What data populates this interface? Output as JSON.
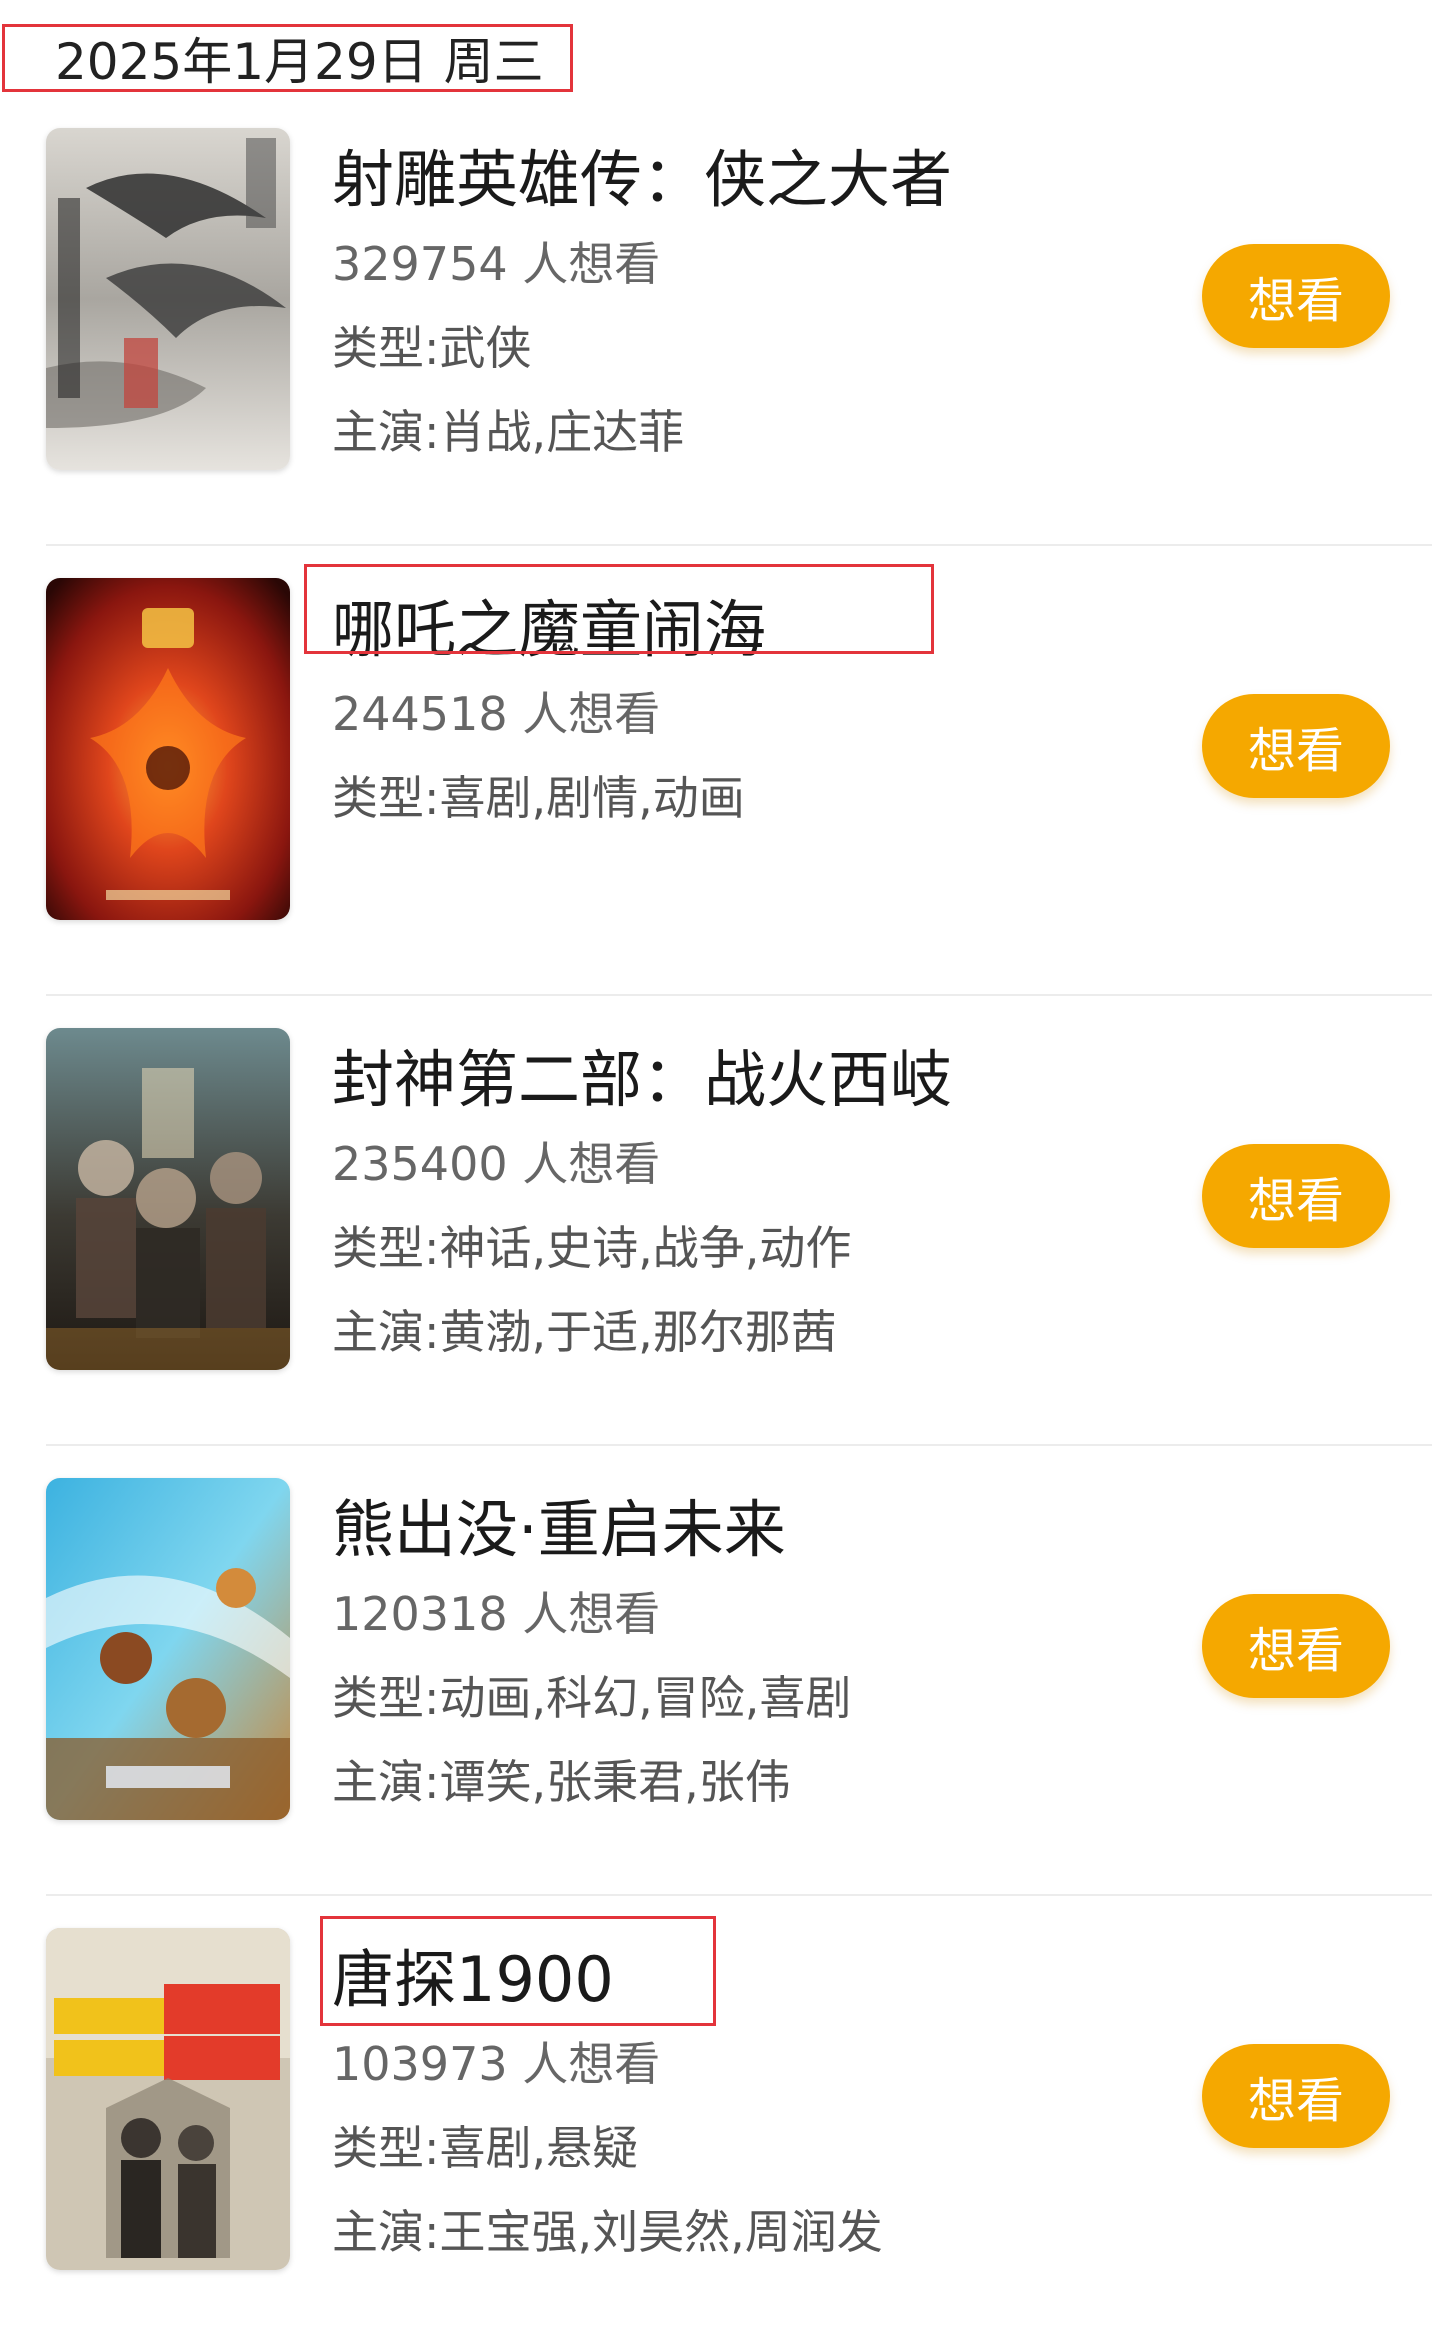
{
  "header": {
    "date": "2025年1月29日 周三"
  },
  "colors": {
    "accent": "#f5a800",
    "highlight": "#e3343b"
  },
  "movies": [
    {
      "title": "射雕英雄传：侠之大者",
      "want_count": "329754 人想看",
      "genre": "类型:武侠",
      "cast": "主演:肖战,庄达菲",
      "button": "想看",
      "poster_icon": "ink-eagle-poster"
    },
    {
      "title": "哪吒之魔童闹海",
      "want_count": "244518 人想看",
      "genre": "类型:喜剧,剧情,动画",
      "button": "想看",
      "poster_icon": "fire-poster"
    },
    {
      "title": "封神第二部：战火西岐",
      "want_count": "235400 人想看",
      "genre": "类型:神话,史诗,战争,动作",
      "cast": "主演:黄渤,于适,那尔那茜",
      "button": "想看",
      "poster_icon": "ensemble-cast-poster"
    },
    {
      "title": "熊出没·重启未来",
      "want_count": "120318 人想看",
      "genre": "类型:动画,科幻,冒险,喜剧",
      "cast": "主演:谭笑,张秉君,张伟",
      "button": "想看",
      "poster_icon": "animated-bears-poster"
    },
    {
      "title": "唐探1900",
      "want_count": "103973 人想看",
      "genre": "类型:喜剧,悬疑",
      "cast": "主演:王宝强,刘昊然,周润发",
      "button": "想看",
      "poster_icon": "vintage-detective-poster"
    }
  ]
}
